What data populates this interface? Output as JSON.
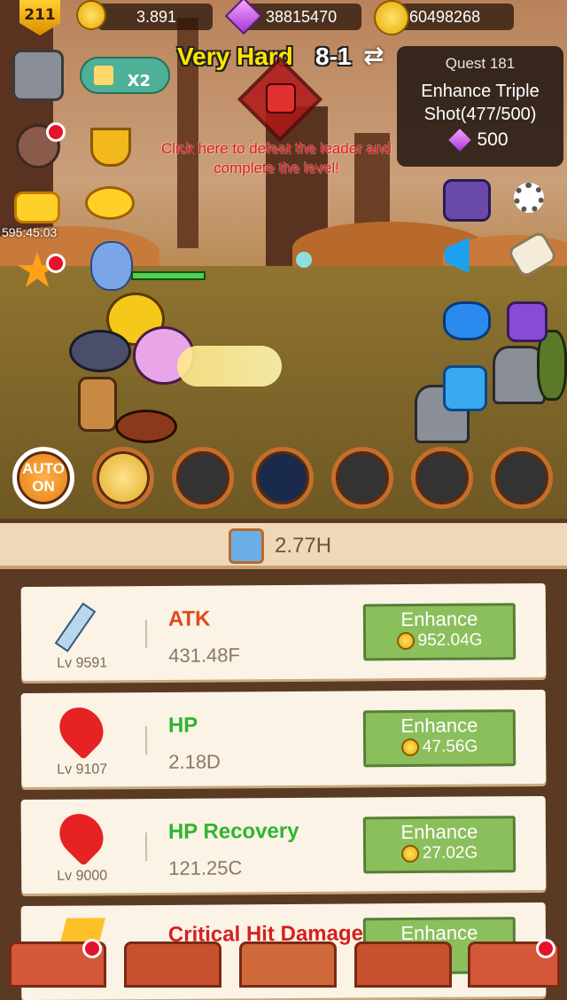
{
  "topbar": {
    "player_level": "211",
    "gold": "3.891",
    "gems": "38815470",
    "coins": "60498268"
  },
  "stage": {
    "difficulty": "Very Hard",
    "level": "8-1",
    "boss_hint": "Click here to defeat the leader and complete the level!"
  },
  "quest": {
    "title": "Quest 181",
    "description": "Enhance Triple Shot(477/500)",
    "reward": "500"
  },
  "left_panel": {
    "speed_label": "X2",
    "timer": "595:45:03"
  },
  "skills": {
    "auto_label": "AUTO ON"
  },
  "dps": {
    "value": "2.77H"
  },
  "upgrades": [
    {
      "name": "ATK",
      "level": "Lv 9591",
      "value": "431.48F",
      "button": "Enhance",
      "cost": "952.04G",
      "color": "#e04a1a"
    },
    {
      "name": "HP",
      "level": "Lv 9107",
      "value": "2.18D",
      "button": "Enhance",
      "cost": "47.56G",
      "color": "#2fb52f"
    },
    {
      "name": "HP Recovery",
      "level": "Lv 9000",
      "value": "121.25C",
      "button": "Enhance",
      "cost": "27.02G",
      "color": "#2fb52f"
    },
    {
      "name": "Critical Hit Damage",
      "level": "",
      "value": "",
      "button": "Enhance",
      "cost": "",
      "color": "#d42020"
    }
  ]
}
